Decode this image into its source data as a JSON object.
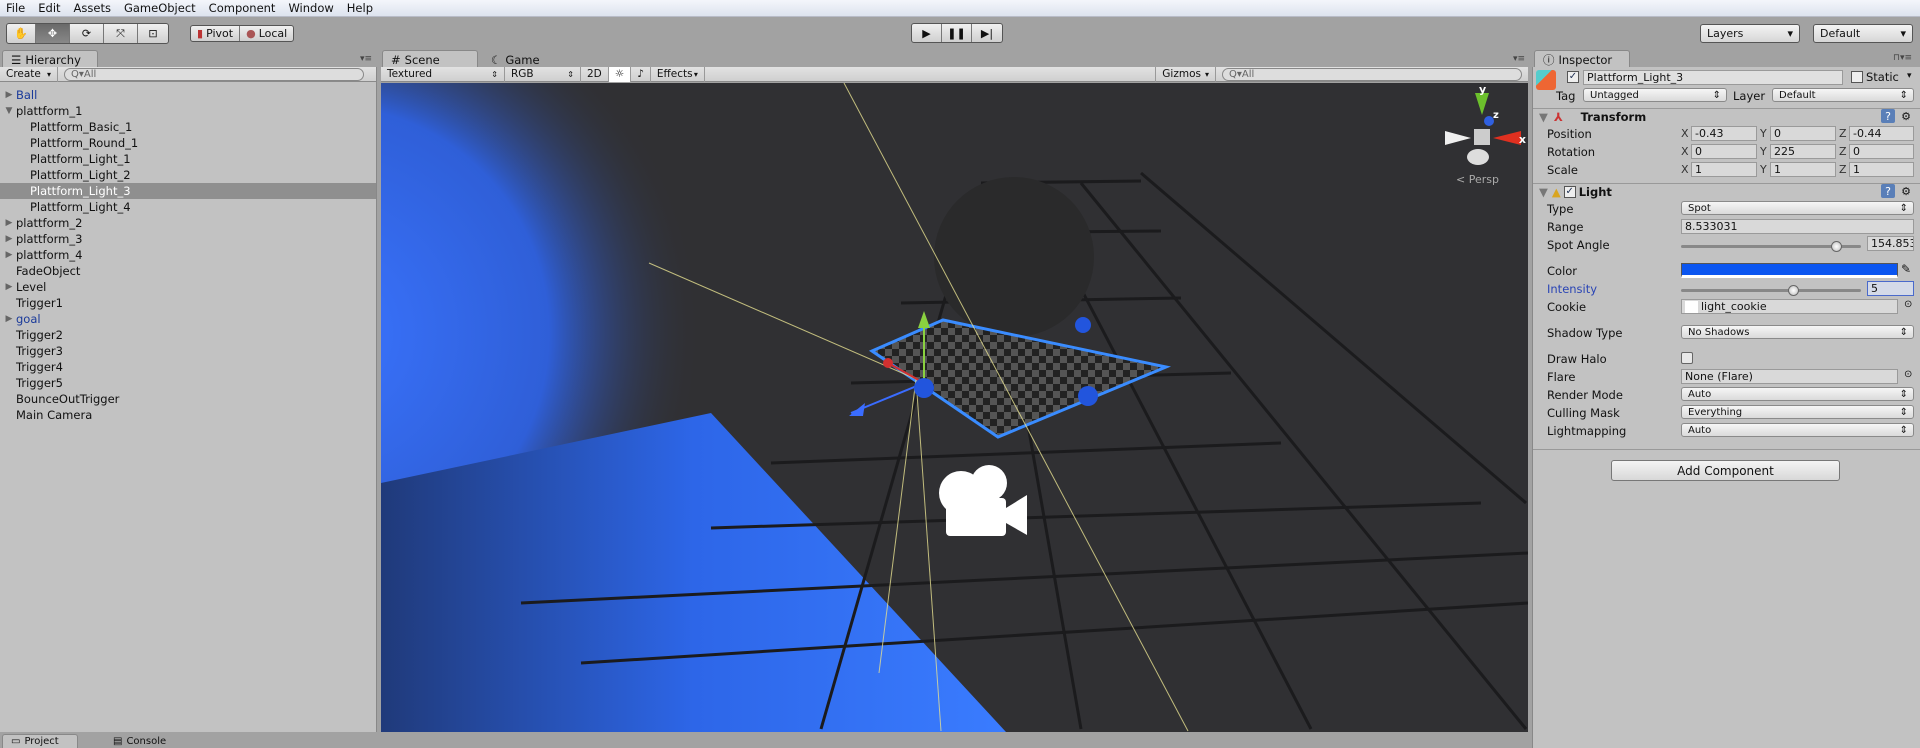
{
  "menu": [
    "File",
    "Edit",
    "Assets",
    "GameObject",
    "Component",
    "Window",
    "Help"
  ],
  "toolbar": {
    "tools": [
      "hand-icon",
      "move-icon",
      "rotate-icon",
      "scale-icon",
      "rect-icon"
    ],
    "pivot": "Pivot",
    "local": "Local",
    "layers": "Layers",
    "layout": "Default"
  },
  "hierarchy": {
    "tab": "Hierarchy",
    "create": "Create",
    "search": "All",
    "items": [
      {
        "label": "Ball",
        "depth": 0,
        "arrow": "closed",
        "blue": true
      },
      {
        "label": "plattform_1",
        "depth": 0,
        "arrow": "open"
      },
      {
        "label": "Plattform_Basic_1",
        "depth": 1
      },
      {
        "label": "Plattform_Round_1",
        "depth": 1
      },
      {
        "label": "Plattform_Light_1",
        "depth": 1
      },
      {
        "label": "Plattform_Light_2",
        "depth": 1
      },
      {
        "label": "Plattform_Light_3",
        "depth": 1,
        "selected": true
      },
      {
        "label": "Plattform_Light_4",
        "depth": 1
      },
      {
        "label": "plattform_2",
        "depth": 0,
        "arrow": "closed"
      },
      {
        "label": "plattform_3",
        "depth": 0,
        "arrow": "closed"
      },
      {
        "label": "plattform_4",
        "depth": 0,
        "arrow": "closed"
      },
      {
        "label": "FadeObject",
        "depth": 0
      },
      {
        "label": "Level",
        "depth": 0,
        "arrow": "closed"
      },
      {
        "label": "Trigger1",
        "depth": 0
      },
      {
        "label": "goal",
        "depth": 0,
        "arrow": "closed",
        "blue": true
      },
      {
        "label": "Trigger2",
        "depth": 0
      },
      {
        "label": "Trigger3",
        "depth": 0
      },
      {
        "label": "Trigger4",
        "depth": 0
      },
      {
        "label": "Trigger5",
        "depth": 0
      },
      {
        "label": "BounceOutTrigger",
        "depth": 0
      },
      {
        "label": "Main Camera",
        "depth": 0
      }
    ]
  },
  "scene": {
    "tab_scene": "Scene",
    "tab_game": "Game",
    "shading": "Textured",
    "render": "RGB",
    "mode2d": "2D",
    "effects": "Effects",
    "gizmos": "Gizmos",
    "search": "All",
    "persp": "Persp",
    "axis_x": "x",
    "axis_y": "y",
    "axis_z": "z"
  },
  "inspector": {
    "tab": "Inspector",
    "name": "Plattform_Light_3",
    "static": "Static",
    "tag_label": "Tag",
    "tag": "Untagged",
    "layer_label": "Layer",
    "layer": "Default",
    "transform": {
      "title": "Transform",
      "rows": [
        {
          "label": "Position",
          "x": "-0.43",
          "y": "0",
          "z": "-0.44"
        },
        {
          "label": "Rotation",
          "x": "0",
          "y": "225",
          "z": "0"
        },
        {
          "label": "Scale",
          "x": "1",
          "y": "1",
          "z": "1"
        }
      ]
    },
    "light": {
      "title": "Light",
      "type_label": "Type",
      "type": "Spot",
      "range_label": "Range",
      "range": "8.533031",
      "spot_label": "Spot Angle",
      "spot": "154.853",
      "spot_frac": 0.86,
      "color_label": "Color",
      "color": "#0a55f0",
      "intensity_label": "Intensity",
      "intensity": "5",
      "intensity_frac": 0.62,
      "cookie_label": "Cookie",
      "cookie": "light_cookie",
      "shadow_label": "Shadow Type",
      "shadow": "No Shadows",
      "halo_label": "Draw Halo",
      "flare_label": "Flare",
      "flare": "None (Flare)",
      "render_label": "Render Mode",
      "render": "Auto",
      "culling_label": "Culling Mask",
      "culling": "Everything",
      "lightmap_label": "Lightmapping",
      "lightmap": "Auto"
    },
    "add_component": "Add Component"
  },
  "bottom": {
    "project": "Project",
    "console": "Console"
  }
}
